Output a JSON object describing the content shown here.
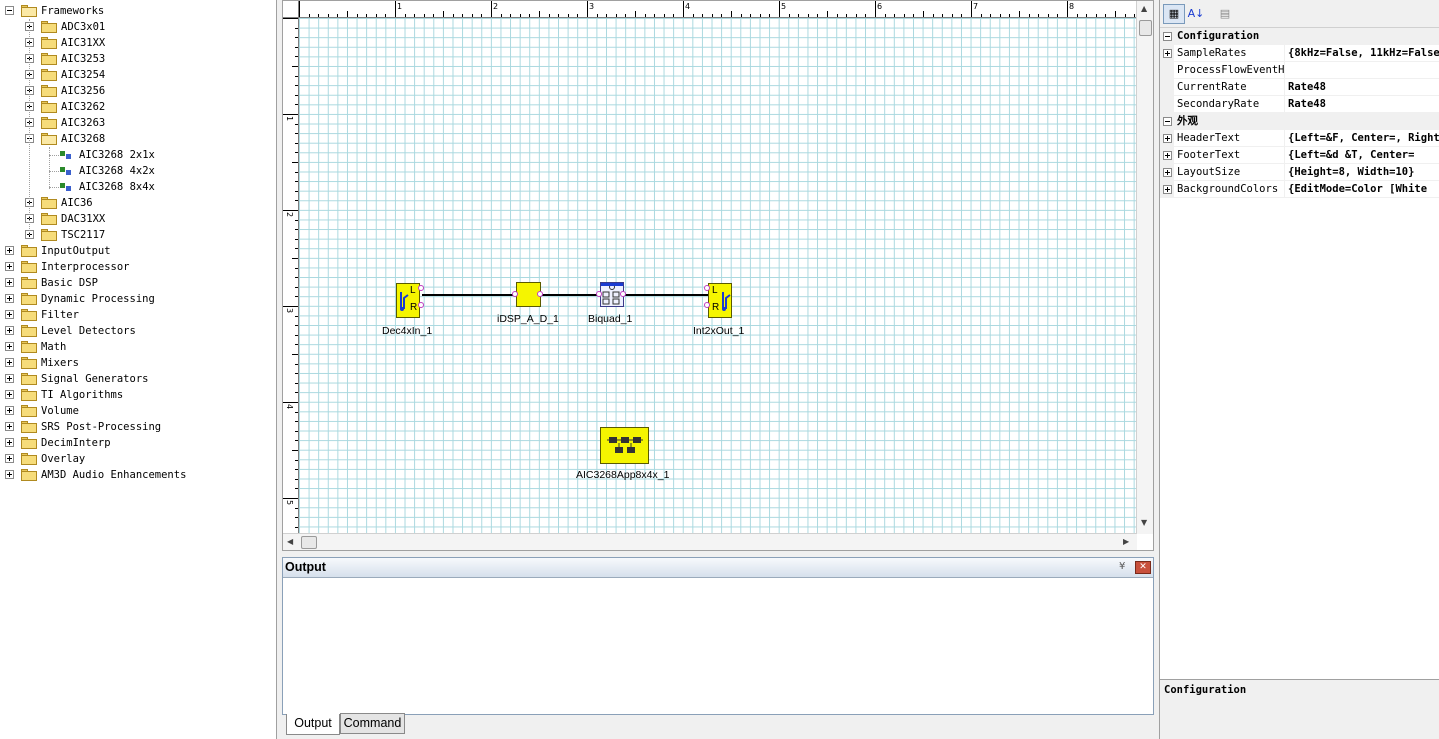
{
  "tree": {
    "items": [
      {
        "label": "Frameworks",
        "level": 0,
        "expanded": true,
        "kind": "folder"
      },
      {
        "label": "ADC3x01",
        "level": 1,
        "expanded": false,
        "kind": "folder"
      },
      {
        "label": "AIC31XX",
        "level": 1,
        "expanded": false,
        "kind": "folder"
      },
      {
        "label": "AIC3253",
        "level": 1,
        "expanded": false,
        "kind": "folder"
      },
      {
        "label": "AIC3254",
        "level": 1,
        "expanded": false,
        "kind": "folder"
      },
      {
        "label": "AIC3256",
        "level": 1,
        "expanded": false,
        "kind": "folder"
      },
      {
        "label": "AIC3262",
        "level": 1,
        "expanded": false,
        "kind": "folder"
      },
      {
        "label": "AIC3263",
        "level": 1,
        "expanded": false,
        "kind": "folder"
      },
      {
        "label": "AIC3268",
        "level": 1,
        "expanded": true,
        "kind": "folder"
      },
      {
        "label": "AIC3268 2x1x",
        "level": 2,
        "kind": "chip"
      },
      {
        "label": "AIC3268 4x2x",
        "level": 2,
        "kind": "chip"
      },
      {
        "label": "AIC3268 8x4x",
        "level": 2,
        "kind": "chip"
      },
      {
        "label": "AIC36",
        "level": 1,
        "expanded": false,
        "kind": "folder"
      },
      {
        "label": "DAC31XX",
        "level": 1,
        "expanded": false,
        "kind": "folder"
      },
      {
        "label": "TSC2117",
        "level": 1,
        "expanded": false,
        "kind": "folder"
      },
      {
        "label": "InputOutput",
        "level": 0,
        "expanded": false,
        "kind": "folder"
      },
      {
        "label": "Interprocessor",
        "level": 0,
        "expanded": false,
        "kind": "folder"
      },
      {
        "label": "Basic DSP",
        "level": 0,
        "expanded": false,
        "kind": "folder"
      },
      {
        "label": "Dynamic Processing",
        "level": 0,
        "expanded": false,
        "kind": "folder"
      },
      {
        "label": "Filter",
        "level": 0,
        "expanded": false,
        "kind": "folder"
      },
      {
        "label": "Level Detectors",
        "level": 0,
        "expanded": false,
        "kind": "folder"
      },
      {
        "label": "Math",
        "level": 0,
        "expanded": false,
        "kind": "folder"
      },
      {
        "label": "Mixers",
        "level": 0,
        "expanded": false,
        "kind": "folder"
      },
      {
        "label": "Signal Generators",
        "level": 0,
        "expanded": false,
        "kind": "folder"
      },
      {
        "label": "TI Algorithms",
        "level": 0,
        "expanded": false,
        "kind": "folder"
      },
      {
        "label": "Volume",
        "level": 0,
        "expanded": false,
        "kind": "folder"
      },
      {
        "label": "SRS Post-Processing",
        "level": 0,
        "expanded": false,
        "kind": "folder"
      },
      {
        "label": "DecimInterp",
        "level": 0,
        "expanded": false,
        "kind": "folder"
      },
      {
        "label": "Overlay",
        "level": 0,
        "expanded": false,
        "kind": "folder"
      },
      {
        "label": "AM3D Audio Enhancements",
        "level": 0,
        "expanded": false,
        "kind": "folder"
      }
    ]
  },
  "ruler": {
    "top_numbers": [
      "1",
      "2",
      "3",
      "4",
      "5",
      "6",
      "7",
      "8"
    ],
    "left_numbers": [
      "1",
      "2",
      "3",
      "4",
      "5"
    ]
  },
  "canvas": {
    "blocks": {
      "dec4xin": {
        "label": "Dec4xIn_1"
      },
      "idsp": {
        "label": "iDSP_A_D_1"
      },
      "biquad": {
        "label": "Biquad_1"
      },
      "int2xout": {
        "label": "Int2xOut_1"
      },
      "app": {
        "label": "AIC3268App8x4x_1"
      }
    },
    "block_text": {
      "l": "L",
      "r": "R"
    }
  },
  "output": {
    "title": "Output",
    "pin_glyph": "¥",
    "close_glyph": "✕",
    "tabs": {
      "output": "Output",
      "command": "Command"
    }
  },
  "properties": {
    "toolbar": {
      "categorized": "▦",
      "alphabetical": "A↓",
      "pages": "▤"
    },
    "categories": {
      "configuration": "Configuration",
      "appearance": "外观"
    },
    "config_rows": [
      {
        "name": "SampleRates",
        "value": "{8kHz=False, 11kHz=False",
        "expandable": true
      },
      {
        "name": "ProcessFlowEventHandler",
        "value": "",
        "expandable": false
      },
      {
        "name": "CurrentRate",
        "value": "Rate48",
        "expandable": false
      },
      {
        "name": "SecondaryRate",
        "value": "Rate48",
        "expandable": false
      }
    ],
    "appearance_rows": [
      {
        "name": "HeaderText",
        "value": "{Left=&F, Center=, Right",
        "expandable": true
      },
      {
        "name": "FooterText",
        "value": "{Left=&d   &T, Center=",
        "expandable": true
      },
      {
        "name": "LayoutSize",
        "value": "{Height=8, Width=10}",
        "expandable": true
      },
      {
        "name": "BackgroundColors",
        "value": "{EditMode=Color [White",
        "expandable": true
      }
    ],
    "description_title": "Configuration"
  },
  "colors": {
    "block_fill": "#f5f500",
    "grid_line": "#a9d8df",
    "port": "#c03cc0"
  }
}
